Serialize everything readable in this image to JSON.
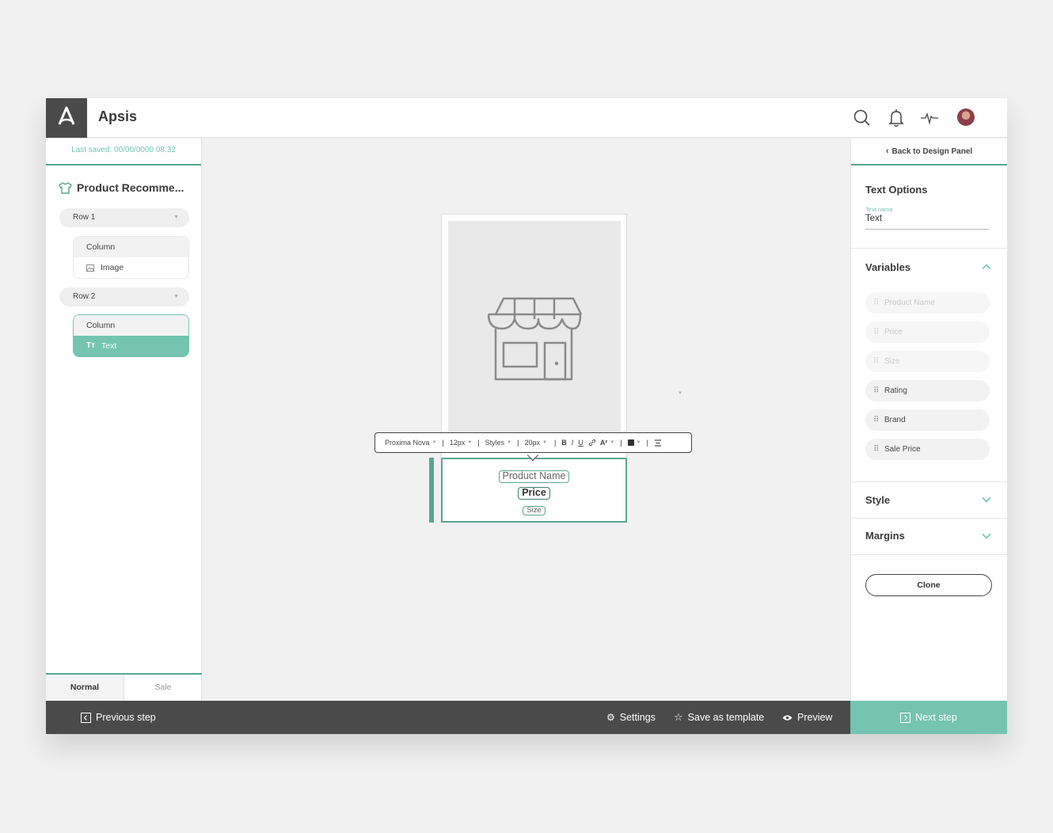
{
  "header": {
    "app_name": "Apsis"
  },
  "left_panel": {
    "last_saved": "Last saved: 00/00/0000  08:32",
    "template_title": "Product Recomme...",
    "rows": [
      {
        "label": "Row 1",
        "column_label": "Column",
        "item_label": "Image",
        "item_icon": "image-icon"
      },
      {
        "label": "Row 2",
        "column_label": "Column",
        "item_label": "Text",
        "item_icon": "text-type-icon"
      }
    ],
    "tabs": [
      "Normal",
      "Sale"
    ]
  },
  "canvas": {
    "variables": {
      "product_name": "Product Name",
      "price": "Price",
      "size": "Size"
    },
    "toolbar": {
      "font": "Proxima Nova",
      "font_size": "12px",
      "styles": "Styles",
      "line_height": "20px",
      "bold": "B",
      "italic": "I",
      "underline": "U",
      "superscript": "A²"
    }
  },
  "right_panel": {
    "back_label": "Back to Design Panel",
    "text_options_title": "Text Options",
    "text_name_label": "Text name",
    "text_name_value": "Text",
    "variables_title": "Variables",
    "variables": [
      {
        "label": "Product Name",
        "enabled": false
      },
      {
        "label": "Price",
        "enabled": false
      },
      {
        "label": "Size",
        "enabled": false
      },
      {
        "label": "Rating",
        "enabled": true
      },
      {
        "label": "Brand",
        "enabled": true
      },
      {
        "label": "Sale Price",
        "enabled": true
      }
    ],
    "style_title": "Style",
    "margins_title": "Margins",
    "clone_label": "Clone"
  },
  "footer": {
    "previous_step": "Previous step",
    "settings": "Settings",
    "save_template": "Save as template",
    "preview": "Preview",
    "next_step": "Next step"
  },
  "colors": {
    "accent": "#74c4b1",
    "accent_dark": "#5aa692",
    "dark_bar": "#4a4a4a"
  }
}
